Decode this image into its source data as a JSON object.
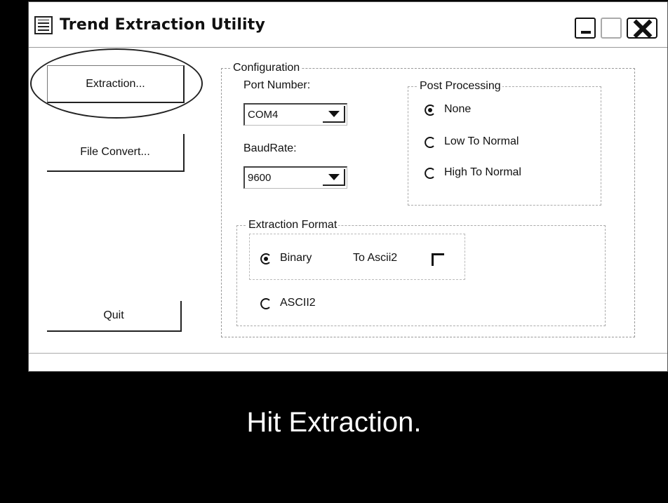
{
  "window": {
    "title": "Trend Extraction Utility"
  },
  "buttons": {
    "extraction": "Extraction...",
    "file_convert": "File Convert...",
    "quit": "Quit"
  },
  "configuration": {
    "group_label": "Configuration",
    "port_number_label": "Port Number:",
    "port_number_value": "COM4",
    "baud_rate_label": "BaudRate:",
    "baud_rate_value": "9600"
  },
  "post_processing": {
    "group_label": "Post Processing",
    "options": [
      {
        "label": "None",
        "selected": true
      },
      {
        "label": "Low To Normal",
        "selected": false
      },
      {
        "label": "High To Normal",
        "selected": false
      }
    ]
  },
  "extraction_format": {
    "group_label": "Extraction Format",
    "options": [
      {
        "label": "Binary",
        "selected": true
      },
      {
        "label": "ASCII2",
        "selected": false
      }
    ],
    "to_ascii2_label": "To Ascii2",
    "to_ascii2_checked": false
  },
  "caption": "Hit Extraction.",
  "colors": {
    "background": "#000000",
    "window": "#ffffff",
    "caption_text": "#ffffff"
  }
}
